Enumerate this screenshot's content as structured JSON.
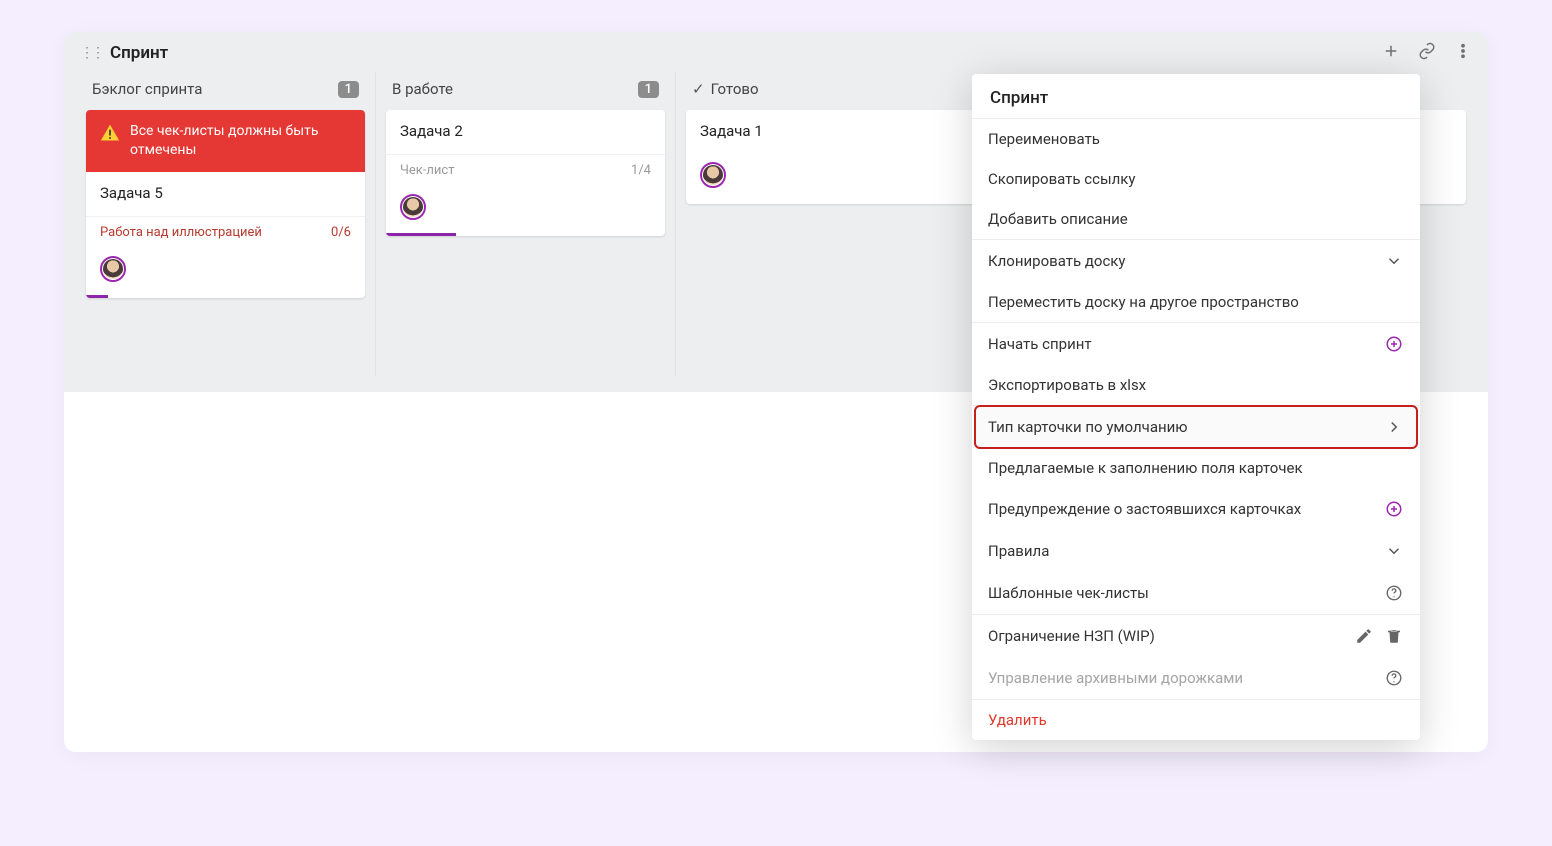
{
  "board": {
    "title": "Спринт",
    "columns": [
      {
        "title": "Бэклог спринта",
        "count": "1",
        "hasCheck": false,
        "cards": [
          {
            "warning": "Все чек-листы должны быть отмечены",
            "title": "Задача 5",
            "checklist": {
              "label": "Работа над иллюстрацией",
              "progress": "0/6",
              "dim": false
            },
            "progressPct": 8
          }
        ]
      },
      {
        "title": "В работе",
        "count": "1",
        "hasCheck": false,
        "cards": [
          {
            "title": "Задача 2",
            "checklist": {
              "label": "Чек-лист",
              "progress": "1/4",
              "dim": true
            },
            "progressPct": 25
          }
        ]
      },
      {
        "title": "Готово",
        "count": null,
        "hasCheck": true,
        "cards": [
          {
            "title": "Задача 1",
            "progressPct": 0
          }
        ]
      }
    ]
  },
  "menu": {
    "title": "Спринт",
    "items": [
      {
        "label": "Переименовать",
        "type": "plain"
      },
      {
        "label": "Скопировать ссылку",
        "type": "plain"
      },
      {
        "label": "Добавить описание",
        "type": "plain",
        "sepAfter": true
      },
      {
        "label": "Клонировать доску",
        "type": "chev-down"
      },
      {
        "label": "Переместить доску на другое пространство",
        "type": "plain",
        "sepAfter": true
      },
      {
        "label": "Начать спринт",
        "type": "plus-circle"
      },
      {
        "label": "Экспортировать в xlsx",
        "type": "plain",
        "sepAfter": true
      },
      {
        "label": "Тип карточки по умолчанию",
        "type": "chev-right",
        "highlighted": true
      },
      {
        "label": "Предлагаемые к заполнению поля карточек",
        "type": "plain"
      },
      {
        "label": "Предупреждение о застоявшихся карточках",
        "type": "plus-circle"
      },
      {
        "label": "Правила",
        "type": "chev-down"
      },
      {
        "label": "Шаблонные чек-листы",
        "type": "help",
        "sepAfter": true
      },
      {
        "label": "Ограничение НЗП (WIP)",
        "type": "edit-trash"
      },
      {
        "label": "Управление архивными дорожками",
        "type": "help",
        "disabled": true,
        "sepAfter": true
      },
      {
        "label": "Удалить",
        "type": "danger"
      }
    ]
  }
}
